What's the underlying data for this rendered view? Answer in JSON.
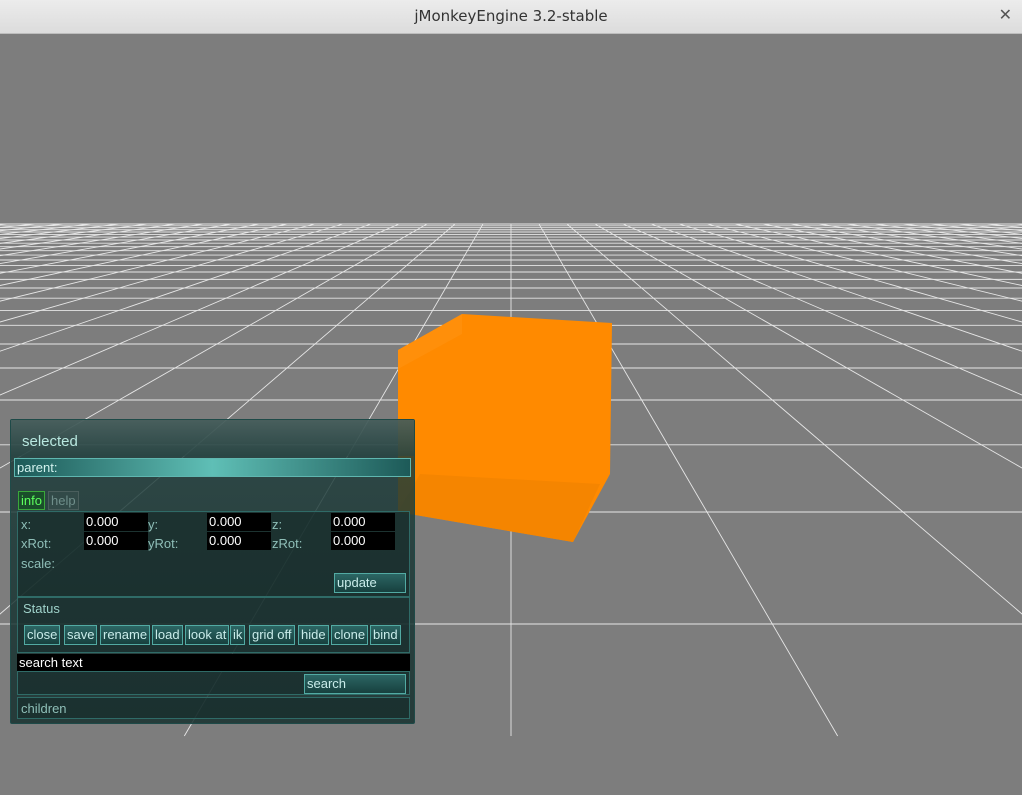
{
  "window": {
    "title": "jMonkeyEngine 3.2-stable",
    "close_symbol": "✕"
  },
  "scene": {
    "background": "#7d7d7d",
    "grid_color": "#e6e6e6",
    "cube_color": "#ff8800"
  },
  "panel": {
    "header": "selected",
    "parent_label": "parent:",
    "tabs": {
      "info": "info",
      "help": "help"
    },
    "fields": {
      "x_label": "x:",
      "x_value": "0.000",
      "y_label": "y:",
      "y_value": "0.000",
      "z_label": "z:",
      "z_value": "0.000",
      "xrot_label": "xRot:",
      "xrot_value": "0.000",
      "yrot_label": "yRot:",
      "yrot_value": "0.000",
      "zrot_label": "zRot:",
      "zrot_value": "0.000",
      "scale_label": "scale:"
    },
    "update_label": "update",
    "status_label": "Status",
    "actions": {
      "close": "close",
      "save": "save",
      "rename": "rename",
      "load": "load",
      "look_at": "look at",
      "ik": "ik",
      "grid_off": "grid off",
      "hide": "hide",
      "clone": "clone",
      "bind": "bind"
    },
    "search_placeholder": "search text",
    "search_label": "search",
    "children_label": "children"
  }
}
